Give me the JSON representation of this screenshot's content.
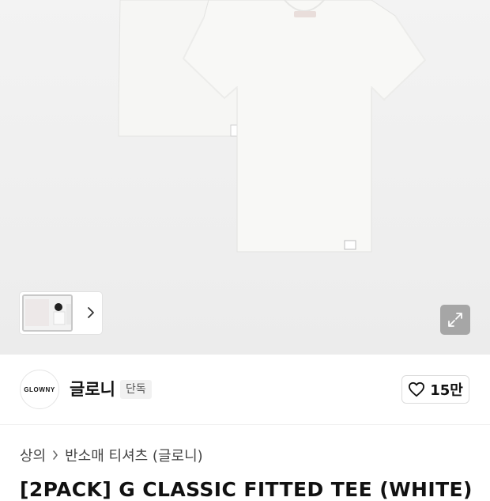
{
  "gallery": {
    "product_image": "white-tee-2pack-photo",
    "thumbnail_count_visible": 1,
    "next_icon": "chevron-right-icon",
    "expand_icon": "expand-arrows-icon"
  },
  "brand": {
    "logo_text": "GLOWNY",
    "name": "글로니",
    "badge": "단독"
  },
  "like": {
    "icon": "heart-outline-icon",
    "count": "15만"
  },
  "breadcrumb": {
    "items": [
      "상의",
      "반소매 티셔츠 (글로니)"
    ],
    "separator_icon": "chevron-right-icon"
  },
  "product": {
    "title": "[2PACK] G CLASSIC FITTED TEE (WHITE)"
  },
  "colors": {
    "hero_bg": "#efefef",
    "shirt": "#f7f7f5",
    "accent_text": "#111111"
  }
}
